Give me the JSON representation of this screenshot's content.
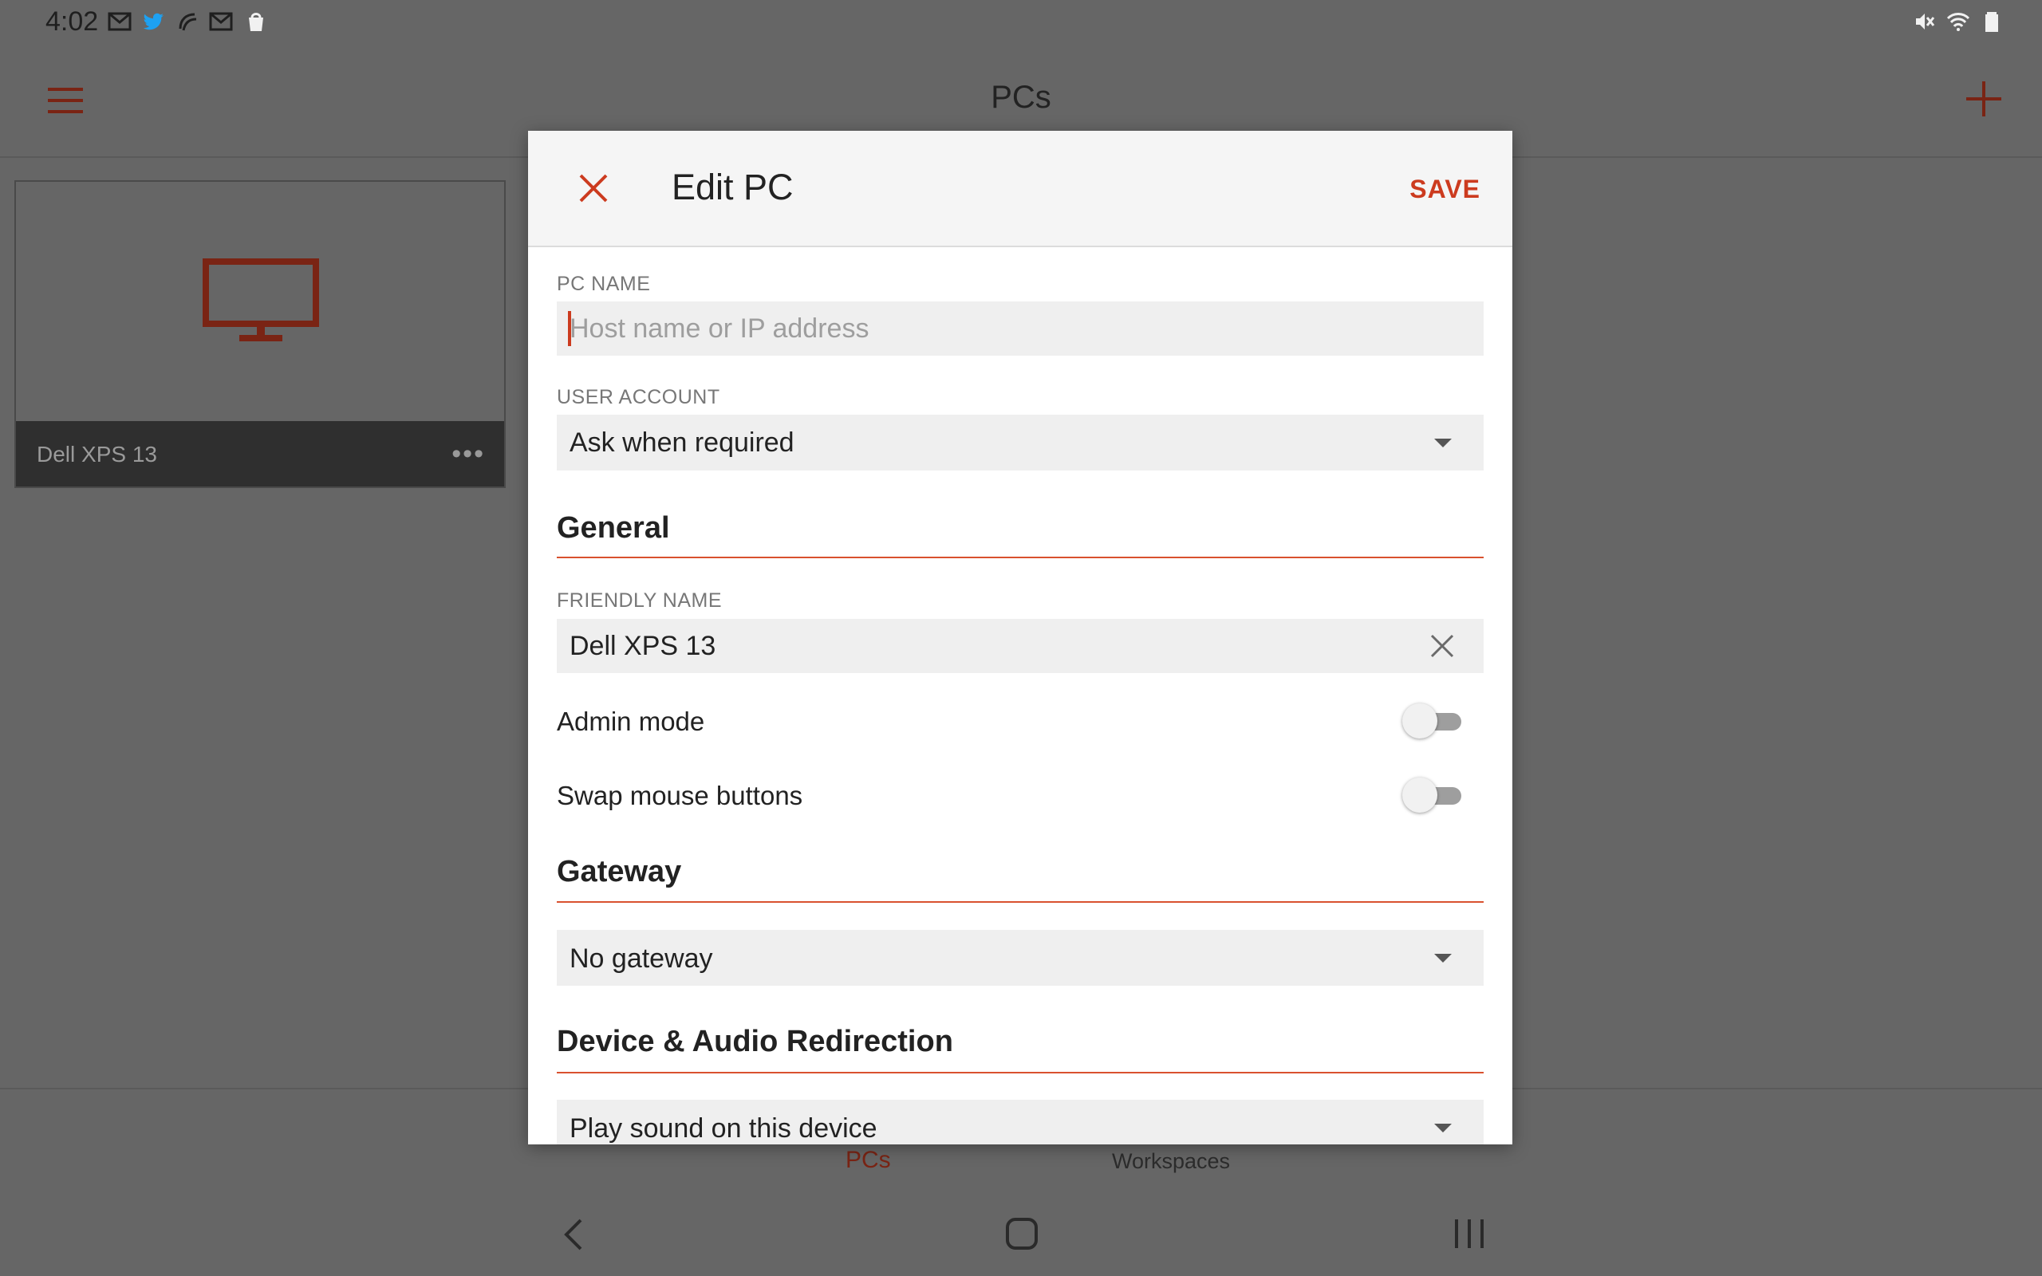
{
  "status_bar": {
    "time": "4:02"
  },
  "app_bar": {
    "title": "PCs"
  },
  "pc_card": {
    "name": "Dell XPS 13",
    "more": "•••"
  },
  "bottom_nav": {
    "pcs_label": "PCs",
    "workspaces_label": "Workspaces"
  },
  "dialog": {
    "title": "Edit PC",
    "save_label": "SAVE",
    "pc_name": {
      "label": "PC NAME",
      "placeholder": "Host name or IP address",
      "value": ""
    },
    "user_account": {
      "label": "USER ACCOUNT",
      "selected": "Ask when required"
    },
    "general": {
      "title": "General",
      "friendly_name": {
        "label": "FRIENDLY NAME",
        "value": "Dell XPS 13"
      },
      "admin_mode": {
        "label": "Admin mode",
        "on": false
      },
      "swap_mouse": {
        "label": "Swap mouse buttons",
        "on": false
      }
    },
    "gateway": {
      "title": "Gateway",
      "selected": "No gateway"
    },
    "device_audio": {
      "title": "Device & Audio Redirection",
      "selected": "Play sound on this device"
    }
  },
  "colors": {
    "accent": "#cc3b1f",
    "overlay": "#666666",
    "dialog_bg": "#ffffff"
  }
}
